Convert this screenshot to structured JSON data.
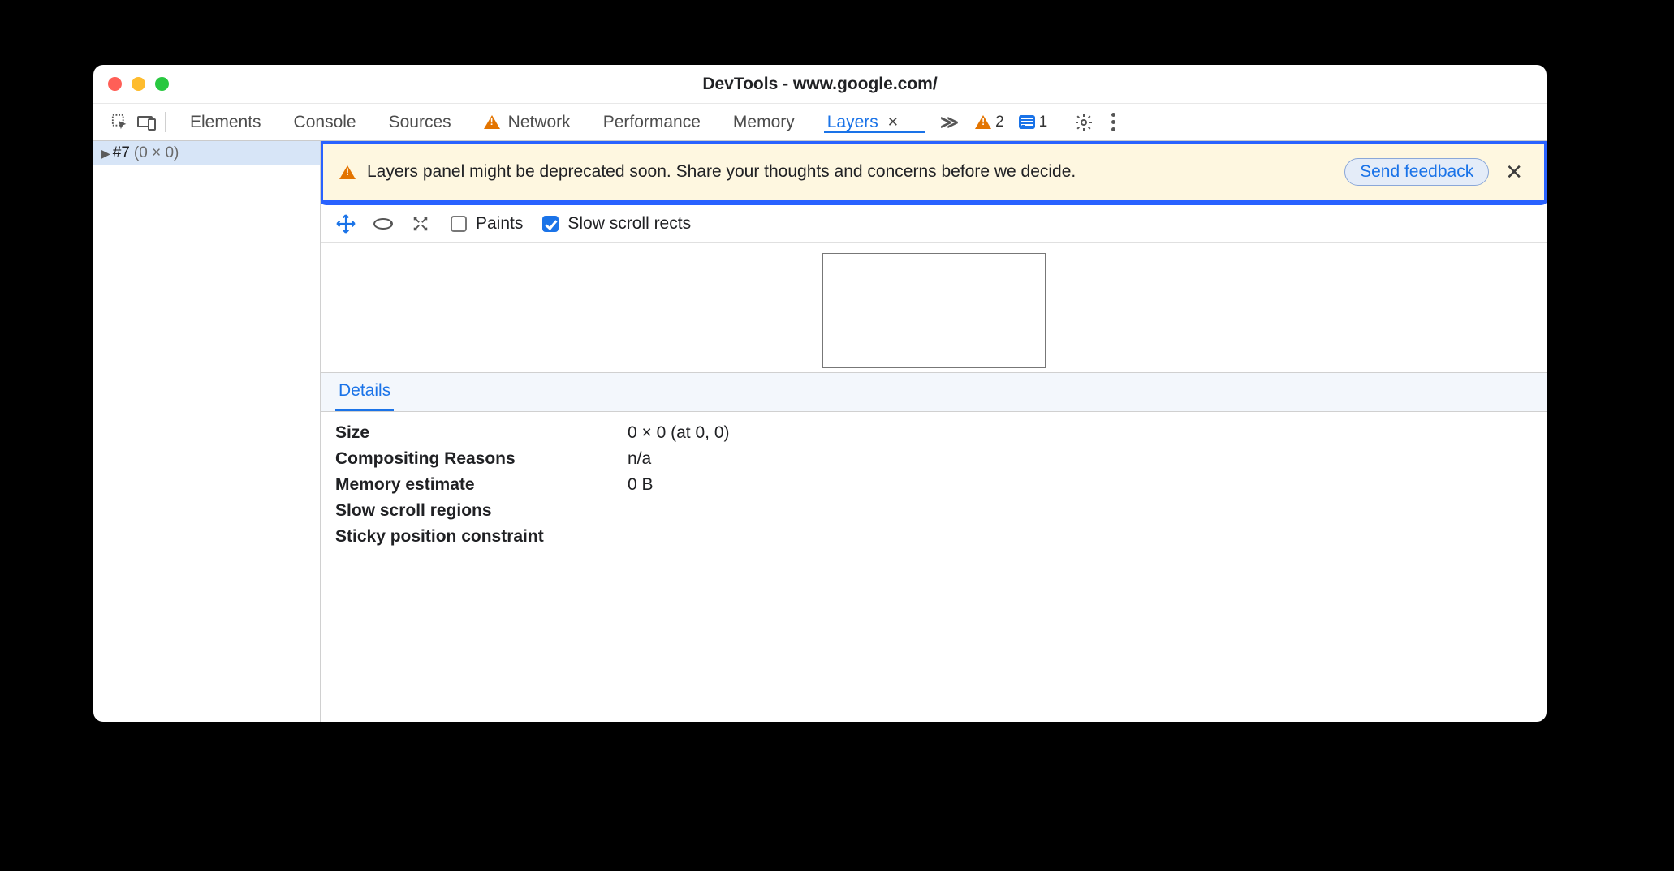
{
  "window": {
    "title": "DevTools - www.google.com/"
  },
  "tabs": {
    "items": [
      "Elements",
      "Console",
      "Sources",
      "Network",
      "Performance",
      "Memory",
      "Layers"
    ],
    "active": "Layers",
    "network_has_warning": true
  },
  "counters": {
    "issues": "2",
    "messages": "1"
  },
  "tree": {
    "node_id": "#7",
    "node_size": "(0 × 0)"
  },
  "banner": {
    "text": "Layers panel might be deprecated soon. Share your thoughts and concerns before we decide.",
    "button": "Send feedback"
  },
  "viewer_toolbar": {
    "paints_label": "Paints",
    "paints_checked": false,
    "slow_label": "Slow scroll rects",
    "slow_checked": true
  },
  "details": {
    "tab": "Details",
    "rows": {
      "size_label": "Size",
      "size_value": "0 × 0 (at 0, 0)",
      "comp_label": "Compositing Reasons",
      "comp_value": "n/a",
      "mem_label": "Memory estimate",
      "mem_value": "0 B",
      "slow_label": "Slow scroll regions",
      "slow_value": "",
      "sticky_label": "Sticky position constraint",
      "sticky_value": ""
    }
  }
}
